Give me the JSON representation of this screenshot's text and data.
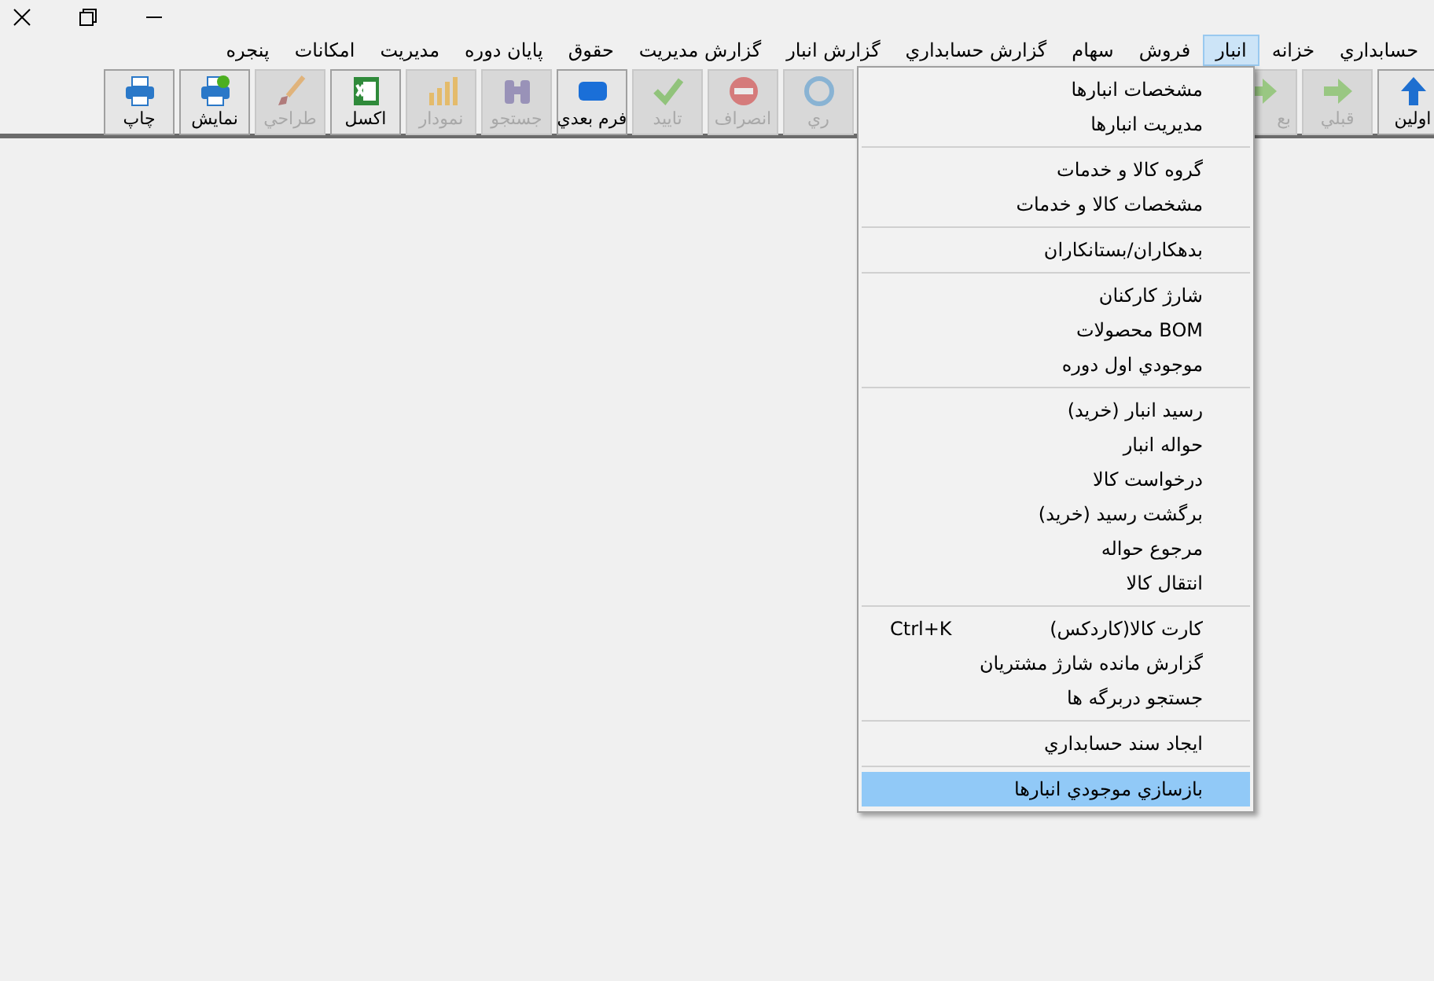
{
  "menu_bar": [
    {
      "label": "حسابداري",
      "selected": false
    },
    {
      "label": "خزانه",
      "selected": false
    },
    {
      "label": "انبار",
      "selected": true
    },
    {
      "label": "فروش",
      "selected": false
    },
    {
      "label": "سهام",
      "selected": false
    },
    {
      "label": "گزارش حسابداري",
      "selected": false
    },
    {
      "label": "گزارش انبار",
      "selected": false
    },
    {
      "label": "گزارش مديريت",
      "selected": false
    },
    {
      "label": "حقوق",
      "selected": false
    },
    {
      "label": "پايان دوره",
      "selected": false
    },
    {
      "label": "مديريت",
      "selected": false
    },
    {
      "label": "امكانات",
      "selected": false
    },
    {
      "label": "پنجره",
      "selected": false
    }
  ],
  "toolbar": [
    {
      "label": "اولين",
      "disabled": false
    },
    {
      "label": "قبلي",
      "disabled": true
    },
    {
      "label": "بع",
      "disabled": true
    },
    {
      "label": "ري",
      "disabled": true
    },
    {
      "label": "انصراف",
      "disabled": true
    },
    {
      "label": "تاييد",
      "disabled": true
    },
    {
      "label": "فرم بعدي",
      "disabled": false
    },
    {
      "label": "جستجو",
      "disabled": true
    },
    {
      "label": "نمودار",
      "disabled": true
    },
    {
      "label": "اكسل",
      "disabled": false
    },
    {
      "label": "طراحي",
      "disabled": true
    },
    {
      "label": "نمايش",
      "disabled": false
    },
    {
      "label": "چاپ",
      "disabled": false
    }
  ],
  "dropdown": [
    {
      "items": [
        {
          "label": "مشخصات انبارها",
          "selected": false
        },
        {
          "label": "مديريت انبارها",
          "selected": false
        }
      ]
    },
    {
      "items": [
        {
          "label": "گروه كالا و خدمات",
          "selected": false
        },
        {
          "label": "مشخصات كالا و خدمات",
          "selected": false
        }
      ]
    },
    {
      "items": [
        {
          "label": "بدهكاران/بستانكاران",
          "selected": false
        }
      ]
    },
    {
      "items": [
        {
          "label": "شارژ كاركنان",
          "selected": false
        },
        {
          "label": "BOM محصولات",
          "selected": false
        },
        {
          "label": "موجودي اول دوره",
          "selected": false
        }
      ]
    },
    {
      "items": [
        {
          "label": "رسيد انبار (خريد)",
          "selected": false
        },
        {
          "label": "حواله انبار",
          "selected": false
        },
        {
          "label": "درخواست كالا",
          "selected": false
        },
        {
          "label": "برگشت رسيد (خريد)",
          "selected": false
        },
        {
          "label": "مرجوع حواله",
          "selected": false
        },
        {
          "label": "انتقال كالا",
          "selected": false
        }
      ]
    },
    {
      "items": [
        {
          "label": "كارت كالا(كاردكس)",
          "shortcut": "Ctrl+K",
          "selected": false
        },
        {
          "label": "گزارش مانده شارژ مشتريان",
          "selected": false
        },
        {
          "label": "جستجو دربرگه ها",
          "selected": false
        }
      ]
    },
    {
      "items": [
        {
          "label": "ايجاد سند حسابداري",
          "selected": false
        }
      ]
    },
    {
      "items": [
        {
          "label": "بازسازي موجودي انبارها",
          "selected": true
        }
      ]
    }
  ]
}
